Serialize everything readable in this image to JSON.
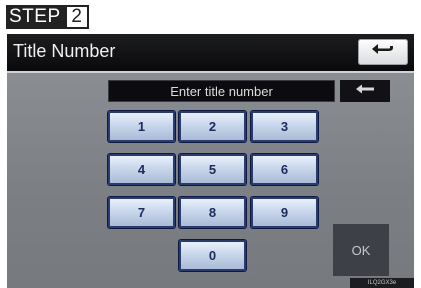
{
  "step": {
    "word": "STEP",
    "number": "2"
  },
  "screen": {
    "title": "Title Number",
    "back_icon": "return-arrow-icon",
    "input_placeholder": "Enter title number",
    "backspace_icon": "backspace-arrow-icon",
    "keys": [
      "1",
      "2",
      "3",
      "4",
      "5",
      "6",
      "7",
      "8",
      "9",
      "0"
    ],
    "ok_label": "OK"
  },
  "footer_code": "ILQ2GX3e"
}
